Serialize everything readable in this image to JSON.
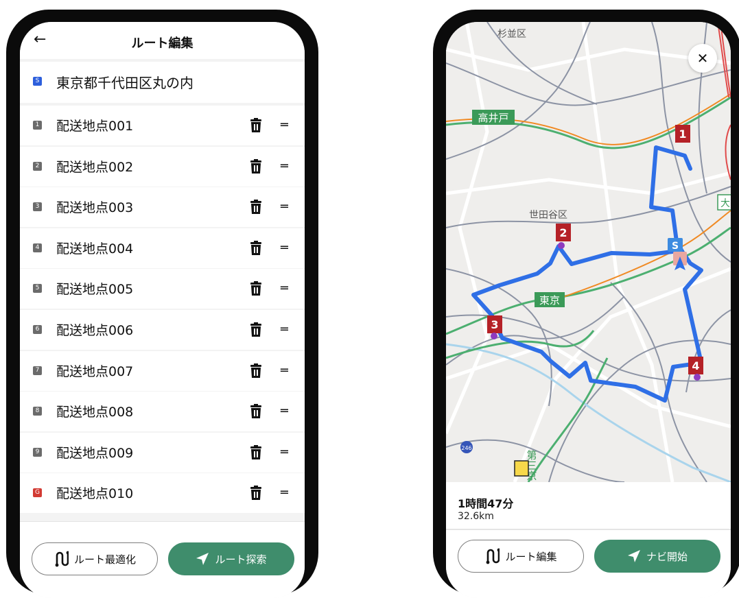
{
  "edit_screen": {
    "title": "ルート編集",
    "back_icon": "arrow-left-icon",
    "start": {
      "badge": "S",
      "label": "東京都千代田区丸の内",
      "badge_color": "#2d5fdc"
    },
    "waypoints": [
      {
        "badge": "1",
        "label": "配送地点001"
      },
      {
        "badge": "2",
        "label": "配送地点002"
      },
      {
        "badge": "3",
        "label": "配送地点003"
      },
      {
        "badge": "4",
        "label": "配送地点004"
      },
      {
        "badge": "5",
        "label": "配送地点005"
      },
      {
        "badge": "6",
        "label": "配送地点006"
      },
      {
        "badge": "7",
        "label": "配送地点007"
      },
      {
        "badge": "8",
        "label": "配送地点008"
      },
      {
        "badge": "9",
        "label": "配送地点009"
      },
      {
        "badge": "G",
        "label": "配送地点010"
      }
    ],
    "waypoint_badge_color": "#6b6b6b",
    "goal_badge_color": "#d23a33",
    "optimize_button": "ルート最適化",
    "search_button": "ルート探索"
  },
  "map_screen": {
    "labels": {
      "suginami": "杉並区",
      "takaido": "高井戸",
      "setagaya": "世田谷区",
      "tokyo": "東京",
      "dai": "大",
      "daisan": "第三京",
      "road246": "246"
    },
    "markers": [
      "1",
      "2",
      "3",
      "4"
    ],
    "start_marker": "S",
    "duration": "1時間47分",
    "distance": "32.6km",
    "edit_button": "ルート編集",
    "navi_button": "ナビ開始"
  },
  "colors": {
    "accent_green": "#3f8d6c",
    "route_blue": "#2f6fe6",
    "marker_red": "#b52127"
  }
}
